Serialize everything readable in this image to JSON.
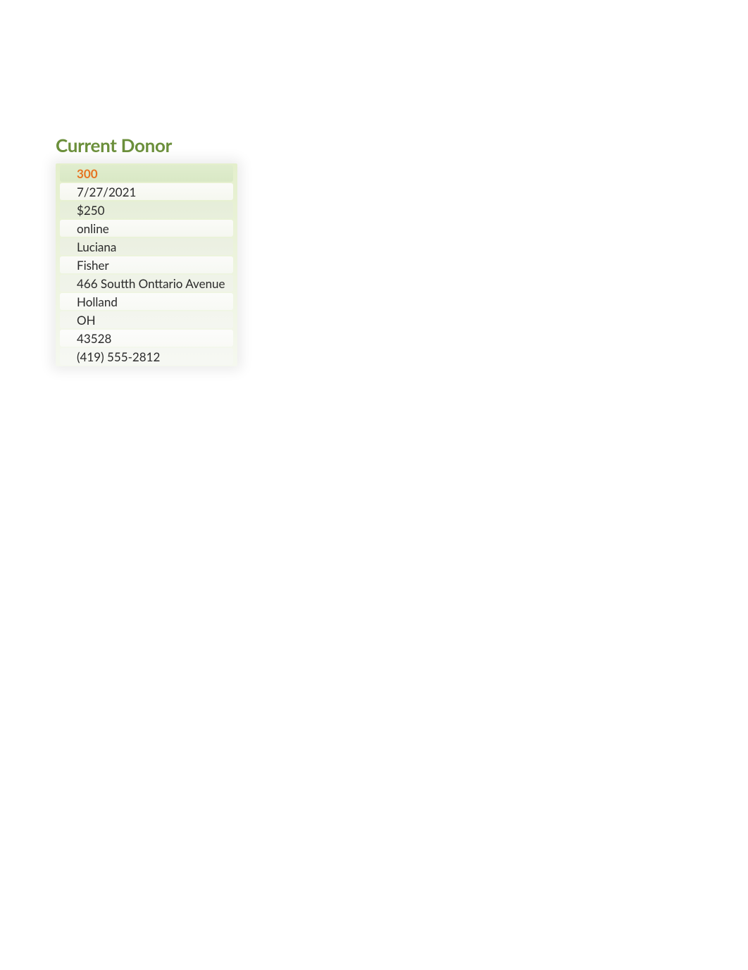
{
  "title": "Current Donor",
  "donor": {
    "id": "300",
    "date": "7/27/2021",
    "amount": "$250",
    "method": "online",
    "firstName": "Luciana",
    "lastName": "Fisher",
    "address": "466 Soutth Onttario Avenue",
    "city": "Holland",
    "state": "OH",
    "zip": "43528",
    "phone": "(419) 555-2812"
  }
}
